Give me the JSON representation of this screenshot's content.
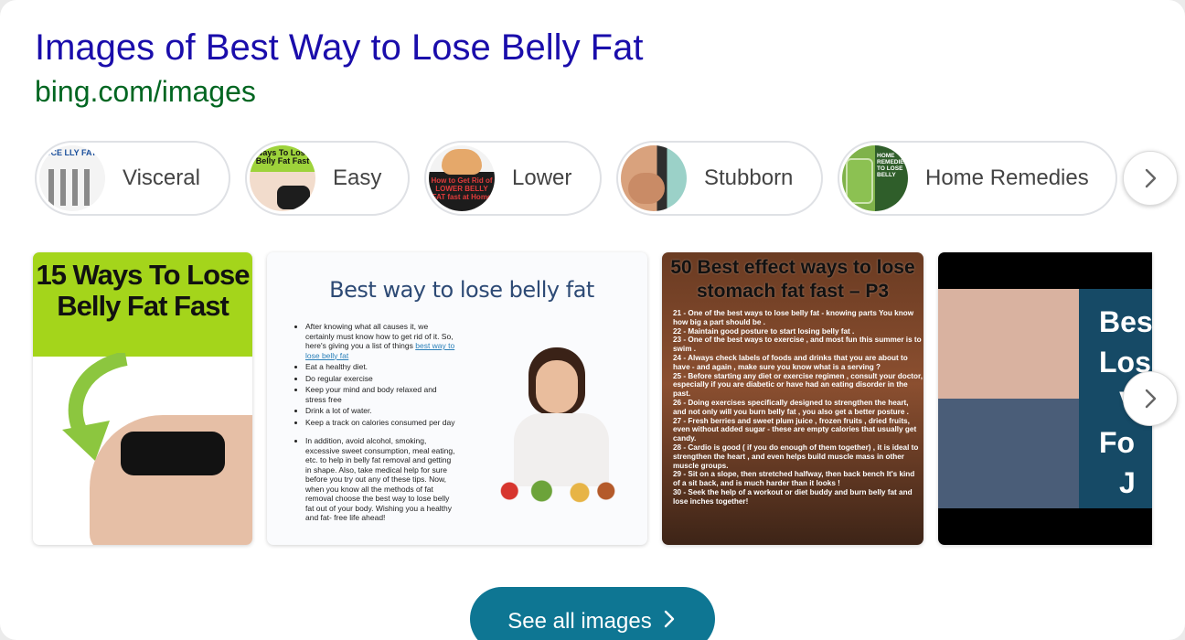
{
  "header": {
    "title": "Images of Best Way to Lose Belly Fat",
    "source": "bing.com/images"
  },
  "related": [
    {
      "label": "Visceral",
      "thumb_text": "UCE LLY FAT"
    },
    {
      "label": "Easy",
      "thumb_text": "Ways To Lose Belly Fat Fast"
    },
    {
      "label": "Lower",
      "thumb_text": "How to Get Rid of LOWER BELLY FAT fast at Home"
    },
    {
      "label": "Stubborn"
    },
    {
      "label": "Home Remedies",
      "thumb_text": "HOME REMEDIES TO LOSE BELLY"
    }
  ],
  "tiles": {
    "t1": {
      "heading": "15 Ways To Lose Belly Fat Fast"
    },
    "t2": {
      "heading": "Best way to lose belly fat",
      "items": [
        "After knowing what all causes it, we certainly must know how to get rid of it. So, here's giving you a list of things",
        "best way to lose belly fat",
        "Eat a healthy diet.",
        "Do regular exercise",
        "Keep your mind and body relaxed and stress free",
        "Drink a lot of water.",
        "Keep a track on calories consumed per day",
        "In addition, avoid alcohol, smoking, excessive sweet consumption, meal eating, etc. to help in belly fat removal and getting in shape. Also, take medical help for sure before you try out any of these tips. Now, when you know all the methods of fat removal choose the best way to lose belly fat out of your body. Wishing you a healthy and fat- free life ahead!"
      ]
    },
    "t3": {
      "heading": "50 Best effect ways to lose stomach fat fast – P3",
      "items": [
        "21 - One of the best ways to lose belly fat - knowing parts You know how big a part should be .",
        "22 - Maintain good posture to start losing belly fat .",
        "23 - One of the best ways to exercise , and most fun this summer is to swim .",
        "24 - Always check labels of foods and drinks that you are about to have - and again , make sure you know what is a serving ?",
        "25 - Before starting any diet or exercise regimen , consult your doctor, especially if you are diabetic or have had an eating disorder in the past.",
        "26 - Doing exercises specifically designed to strengthen the heart, and not only will you burn belly fat , you also get a better posture .",
        "27 - Fresh berries and sweet plum juice , frozen fruits , dried fruits, even without added sugar - these are empty calories that usually get candy.",
        "28 - Cardio is good ( if you do enough of them together) , it is ideal to strengthen the heart , and even helps build muscle mass in other muscle groups.",
        "29 - Sit on a slope, then stretched halfway, then back bench It's kind of a sit back, and is much harder than it looks !",
        "30 - Seek the help of a workout or diet buddy and burn belly fat and lose inches together!"
      ]
    },
    "t4": {
      "lines": [
        "Bes",
        "Los",
        "V",
        "Fo",
        "J"
      ]
    }
  },
  "see_all": {
    "label": "See all images"
  },
  "icons": {
    "chevron": "chevron-right-icon"
  },
  "colors": {
    "title": "#1a0dab",
    "source": "#006621",
    "see_all_bg": "#0e7693"
  }
}
